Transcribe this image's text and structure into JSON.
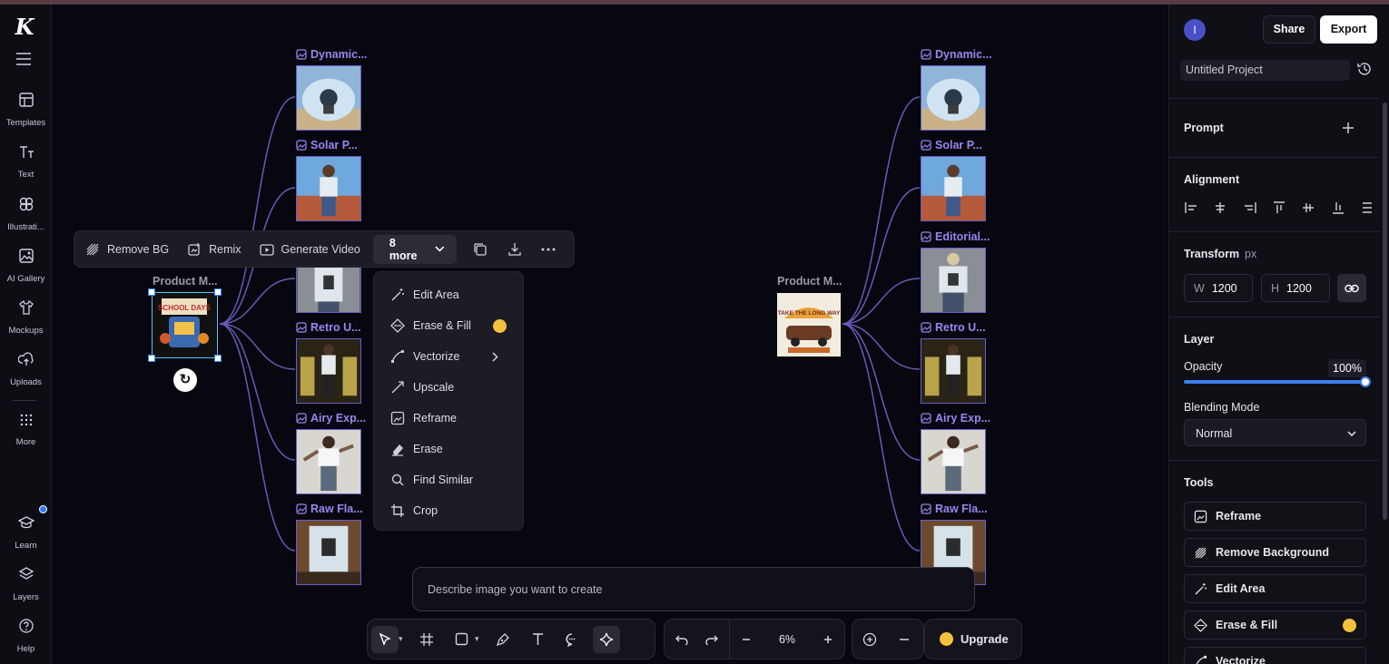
{
  "sidebar": {
    "logo": "K",
    "items": [
      {
        "label": "Templates"
      },
      {
        "label": "Text"
      },
      {
        "label": "Illustrati..."
      },
      {
        "label": "AI Gallery"
      },
      {
        "label": "Mockups"
      },
      {
        "label": "Uploads"
      },
      {
        "label": "More"
      },
      {
        "label": "Learn"
      },
      {
        "label": "Layers"
      },
      {
        "label": "Help"
      }
    ]
  },
  "canvas": {
    "left_group": {
      "source_label": "Product M...",
      "nodes": [
        {
          "label": "Dynamic..."
        },
        {
          "label": "Solar P..."
        },
        {
          "label": "Retro U..."
        },
        {
          "label": "Airy Exp..."
        },
        {
          "label": "Raw Fla..."
        }
      ]
    },
    "right_group": {
      "source_label": "Product M...",
      "nodes": [
        {
          "label": "Dynamic..."
        },
        {
          "label": "Solar P..."
        },
        {
          "label": "Editorial..."
        },
        {
          "label": "Retro U..."
        },
        {
          "label": "Airy Exp..."
        },
        {
          "label": "Raw Fla..."
        }
      ]
    },
    "source_art_text": {
      "left": "SCHOOL DAYS",
      "right": "TAKE THE LONG WAY"
    }
  },
  "float_toolbar": {
    "remove_bg": "Remove BG",
    "remix": "Remix",
    "generate_video": "Generate Video",
    "more": "8 more"
  },
  "dropdown": {
    "items": [
      {
        "label": "Edit Area"
      },
      {
        "label": "Erase & Fill"
      },
      {
        "label": "Vectorize"
      },
      {
        "label": "Upscale"
      },
      {
        "label": "Reframe"
      },
      {
        "label": "Erase"
      },
      {
        "label": "Find Similar"
      },
      {
        "label": "Crop"
      }
    ]
  },
  "prompt": {
    "placeholder": "Describe image you want to create"
  },
  "bottom_toolbar": {
    "zoom": "6%",
    "upgrade": "Upgrade"
  },
  "panel": {
    "avatar": "I",
    "share": "Share",
    "export": "Export",
    "project_name": "Untitled Project",
    "prompt_title": "Prompt",
    "alignment_title": "Alignment",
    "transform_title": "Transform",
    "transform_unit": "px",
    "width_key": "W",
    "width_value": "1200",
    "height_key": "H",
    "height_value": "1200",
    "layer_title": "Layer",
    "opacity_label": "Opacity",
    "opacity_value": "100%",
    "opacity_level": 1.0,
    "blending_label": "Blending Mode",
    "blending_value": "Normal",
    "tools_title": "Tools",
    "tools": [
      {
        "label": "Reframe"
      },
      {
        "label": "Remove Background"
      },
      {
        "label": "Edit Area"
      },
      {
        "label": "Erase & Fill"
      },
      {
        "label": "Vectorize"
      }
    ]
  },
  "colors": {
    "accent": "#9a86f0",
    "wire": "#6a5ab8",
    "selection": "#5cc3ff",
    "slider": "#3b7ff0",
    "crown": "#f2c23d"
  }
}
